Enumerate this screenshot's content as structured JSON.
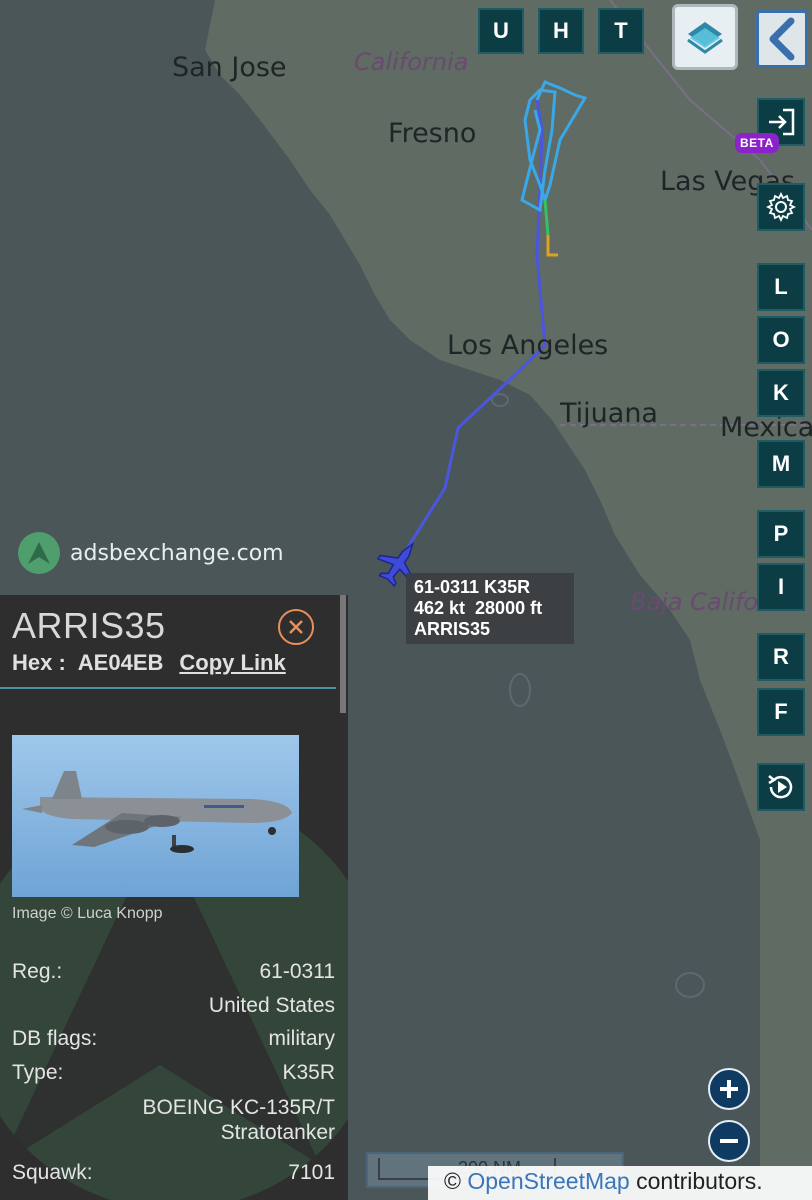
{
  "map": {
    "cities": [
      {
        "name": "San Jose"
      },
      {
        "name": "Fresno"
      },
      {
        "name": "Las Vegas"
      },
      {
        "name": "Los Angeles"
      },
      {
        "name": "Tijuana"
      },
      {
        "name": "Mexica"
      }
    ],
    "regions": [
      {
        "name": "California"
      },
      {
        "name": "Baja Califo"
      }
    ],
    "track_colors": {
      "main": "#4a56e0",
      "loop": "#3aa8e8",
      "tail_green": "#39c060",
      "tail_orange": "#e3a020"
    }
  },
  "top_buttons": [
    "U",
    "H",
    "T"
  ],
  "side_buttons": [
    "L",
    "O",
    "K",
    "M",
    "P",
    "I",
    "R",
    "F"
  ],
  "icons": {
    "layers": "layers-icon",
    "back": "chevron-left-icon",
    "login": "login-icon",
    "settings": "gear-icon",
    "replay": "replay-icon"
  },
  "beta_label": "BETA",
  "watermark": "adsbexchange.com",
  "aircraft_label": {
    "line1": "61-0311 K35R",
    "line2": "462 kt  28000 ft",
    "line3": "ARRIS35"
  },
  "panel": {
    "callsign": "ARRIS35",
    "hex_label": "Hex :",
    "hex_value": "AE04EB",
    "copy_link": "Copy Link",
    "photo_credit": "Image © Luca Knopp",
    "reg_label": "Reg.:",
    "reg_value": "61-0311",
    "country": "United States",
    "dbflags_label": "DB flags:",
    "dbflags_value": "military",
    "type_label": "Type:",
    "type_value": "K35R",
    "type_desc_1": "BOEING KC-135R/T",
    "type_desc_2": "Stratotanker",
    "squawk_label": "Squawk:",
    "squawk_value": "7101"
  },
  "scale_label": "200 NM",
  "attribution": {
    "prefix": "© ",
    "link": "OpenStreetMap",
    "suffix": " contributors."
  },
  "colors": {
    "button_bg": "#0d3d44",
    "panel_bg": "#2e2e2e",
    "accent_line": "#4a90a8",
    "close_ring": "#e88f5a",
    "beta_bg": "#8c22c9",
    "zoom_bg": "#0f3b63"
  }
}
